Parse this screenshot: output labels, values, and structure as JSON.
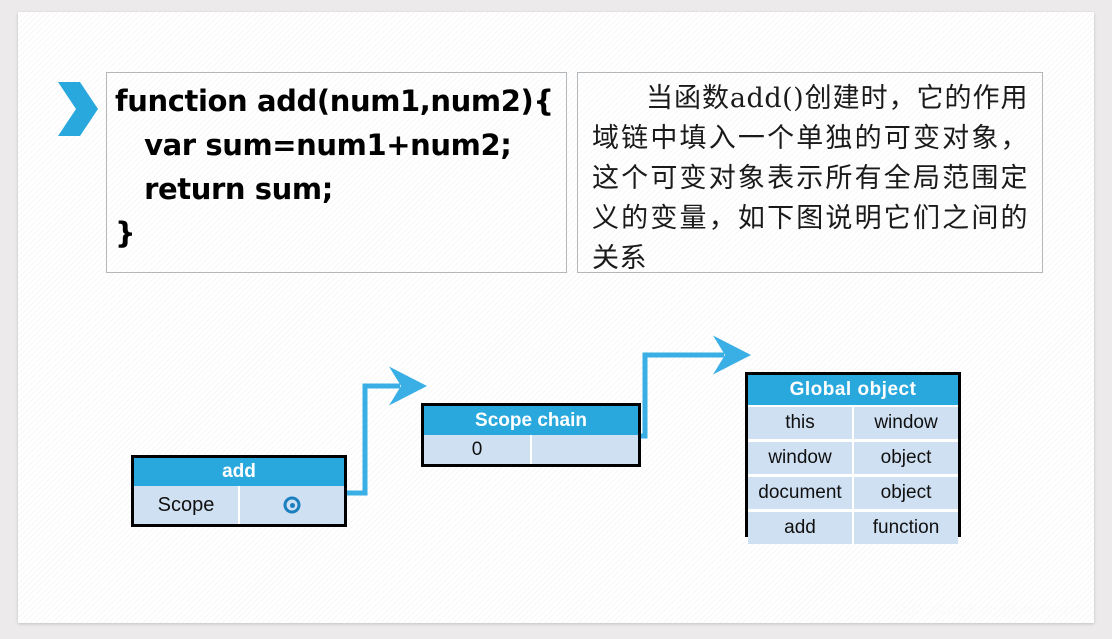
{
  "slide": {
    "bullet_icon": "chevron-right-icon",
    "watermark": "https://blog.csdn.net/szmtjs10"
  },
  "code_box": {
    "lines": [
      "function add(num1,num2){",
      "   var sum=num1+num2;",
      "   return sum;",
      "}"
    ]
  },
  "note_box": {
    "text": "当函数add()创建时，它的作用域链中填入一个单独的可变对象，这个可变对象表示所有全局范围定义的变量，如下图说明它们之间的关系"
  },
  "diagram": {
    "add_box": {
      "title": "add",
      "rows": [
        {
          "label": "Scope",
          "value": "",
          "connector_icon": "scope-connector-dot-icon"
        }
      ]
    },
    "scope_chain_box": {
      "title": "Scope chain",
      "rows": [
        {
          "label": "0",
          "value": ""
        }
      ]
    },
    "global_object_box": {
      "title": "Global  object",
      "rows": [
        {
          "label": "this",
          "value": "window"
        },
        {
          "label": "window",
          "value": "object"
        },
        {
          "label": "document",
          "value": "object"
        },
        {
          "label": "add",
          "value": "function"
        }
      ]
    },
    "connectors": [
      {
        "name": "add-to-scope-chain",
        "from": "add_box.Scope",
        "to": "scope_chain_box"
      },
      {
        "name": "scope-chain-to-global-object",
        "from": "scope_chain_box.0",
        "to": "global_object_box"
      }
    ]
  },
  "colors": {
    "header_blue": "#29a8dd",
    "cell_blue": "#cfe0f2",
    "connector_blue": "#3aafe6",
    "border_black": "#000000",
    "textbox_border": "#b4b7ba"
  }
}
